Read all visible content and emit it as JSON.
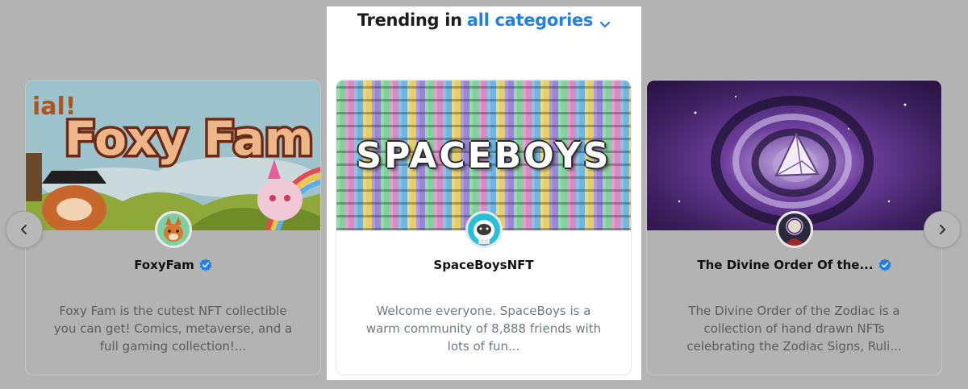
{
  "heading": {
    "prefix": "Trending in",
    "category": "all categories"
  },
  "carousel": {
    "prev_icon": "chevron-left-icon",
    "next_icon": "chevron-right-icon",
    "cards": [
      {
        "name": "FoxyFam",
        "verified": true,
        "banner_text": "Foxy Fam",
        "banner_text_left": "ial!",
        "description": "Foxy Fam is the cutest NFT collectible you can get! Comics, metaverse, and a full gaming collection!..."
      },
      {
        "name": "SpaceBoysNFT",
        "verified": false,
        "banner_text": "SPACEBOYS",
        "description": "Welcome everyone. SpaceBoys is a warm community of 8,888 friends with lots of fun..."
      },
      {
        "name": "The Divine Order Of the...",
        "verified": true,
        "description": "The Divine Order of the Zodiac is a collection of hand drawn NFTs celebrating the Zodiac Signs, Ruli..."
      }
    ]
  },
  "colors": {
    "accent": "#2081e2",
    "verified_badge": "#2081e2",
    "backdrop": "#b3b3b3"
  }
}
